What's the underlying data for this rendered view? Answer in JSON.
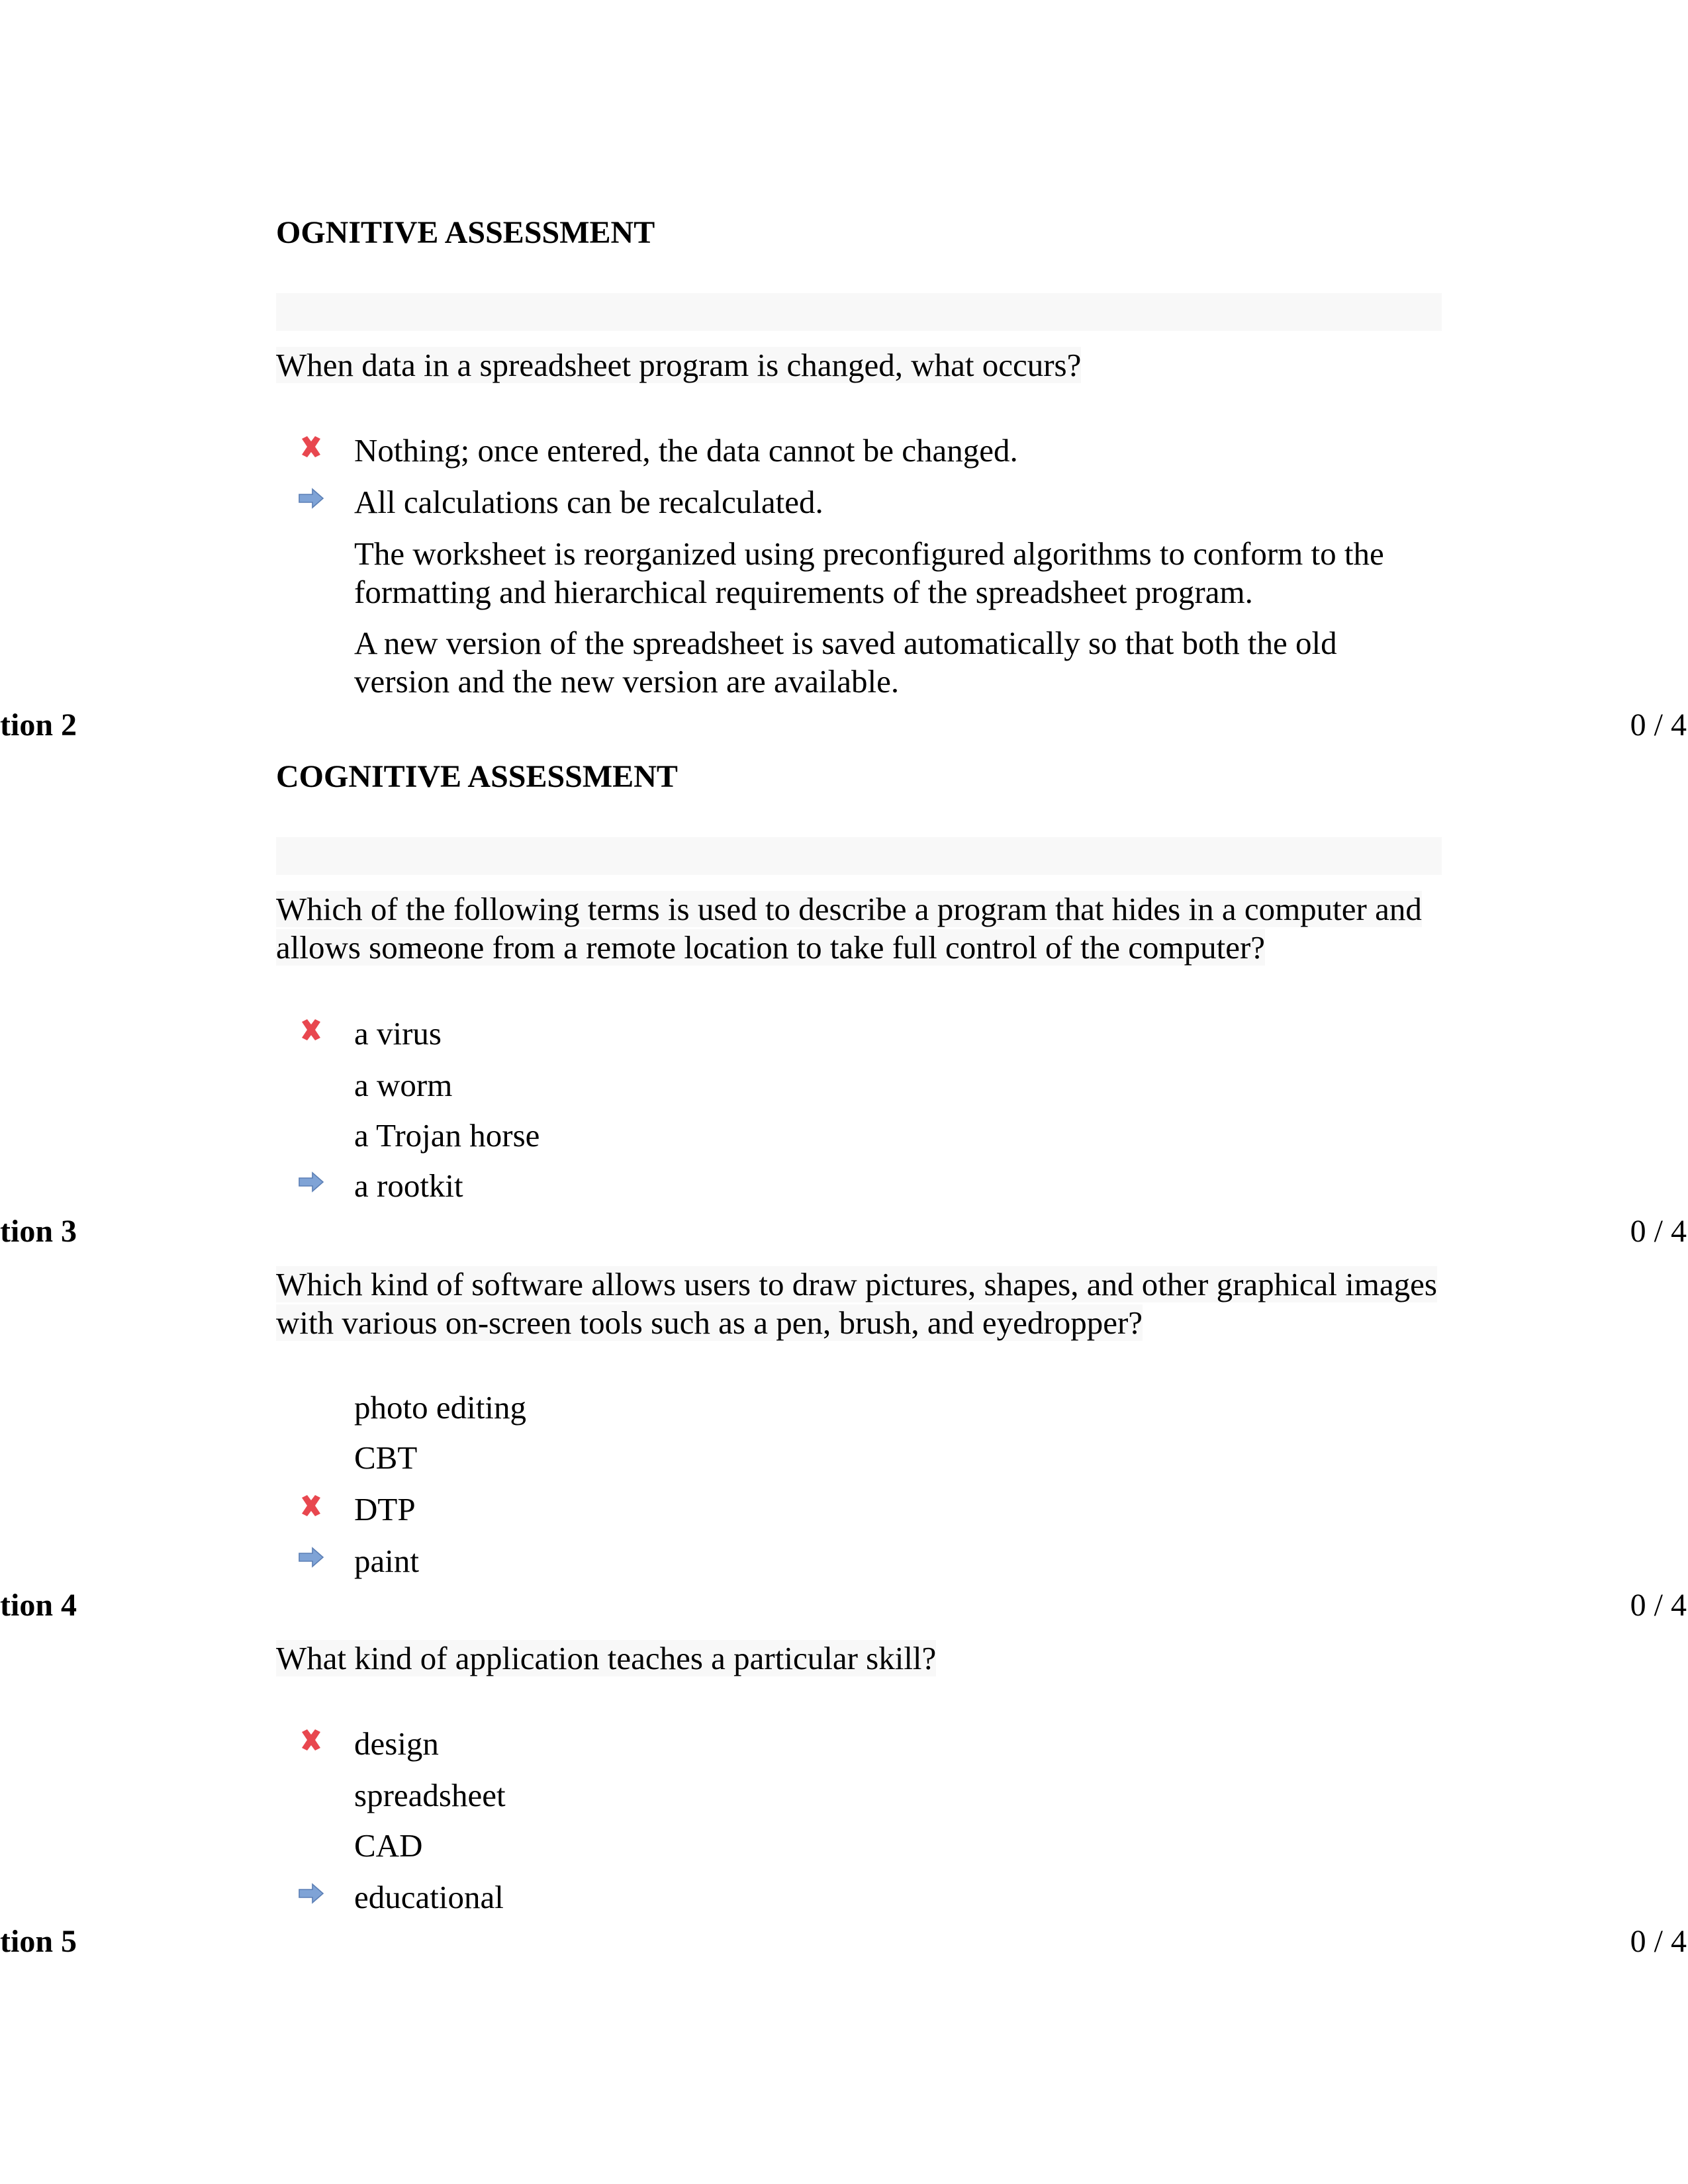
{
  "questions": [
    {
      "heading": "OGNITIVE ASSESSMENT",
      "text": "When data in a spreadsheet program is changed, what occurs?",
      "answers": [
        {
          "text": "Nothing; once entered, the data cannot be changed.",
          "marker": "incorrect-x"
        },
        {
          "text": "All calculations can be recalculated.",
          "marker": "correct-arrow"
        },
        {
          "text": "The worksheet is reorganized using preconfigured algorithms to conform to the formatting and hierarchical requirements of the spreadsheet program.",
          "marker": "none"
        },
        {
          "text": "A new version of the spreadsheet is saved automatically so that both the old version and the new version are available.",
          "marker": "none"
        }
      ]
    },
    {
      "label": "tion 2",
      "score": "0 / 4",
      "heading": "COGNITIVE ASSESSMENT",
      "text": "Which of the following terms is used to describe a program that hides in a computer and allows someone from a remote location to take full control of the computer?",
      "answers": [
        {
          "text": "a virus",
          "marker": "incorrect-x"
        },
        {
          "text": "a worm",
          "marker": "none"
        },
        {
          "text": "a Trojan horse",
          "marker": "none"
        },
        {
          "text": "a rootkit",
          "marker": "correct-arrow"
        }
      ]
    },
    {
      "label": "tion 3",
      "score": "0 / 4",
      "text": "Which kind of software allows users to draw pictures, shapes, and other graphical images with various on-screen tools such as a pen, brush, and eyedropper?",
      "answers": [
        {
          "text": "photo editing",
          "marker": "none"
        },
        {
          "text": "CBT",
          "marker": "none"
        },
        {
          "text": "DTP",
          "marker": "incorrect-x"
        },
        {
          "text": "paint",
          "marker": "correct-arrow"
        }
      ]
    },
    {
      "label": "tion 4",
      "score": "0 / 4",
      "text": "What kind of application teaches a particular skill?",
      "answers": [
        {
          "text": "design",
          "marker": "incorrect-x"
        },
        {
          "text": "spreadsheet",
          "marker": "none"
        },
        {
          "text": "CAD",
          "marker": "none"
        },
        {
          "text": "educational",
          "marker": "correct-arrow"
        }
      ]
    },
    {
      "label": "tion 5",
      "score": "0 / 4"
    }
  ],
  "colors": {
    "incorrect": "#e8474f",
    "correct": "#7fa3d6",
    "highlight_bg": "#f8f8f8"
  }
}
